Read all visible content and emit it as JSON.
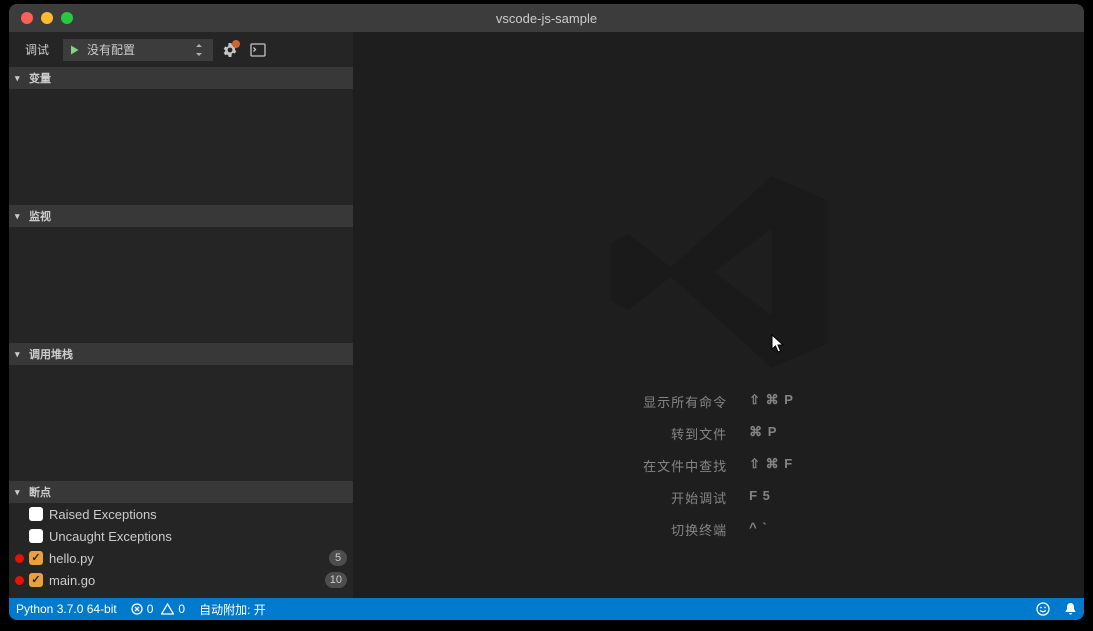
{
  "window": {
    "title": "vscode-js-sample"
  },
  "sidebar": {
    "title": "调试",
    "config": {
      "label": "没有配置"
    },
    "panels": {
      "variables": "变量",
      "watch": "监视",
      "callstack": "调用堆栈",
      "breakpoints": "断点"
    },
    "breakpoints": [
      {
        "label": "Raised Exceptions",
        "checked": false,
        "dot": false,
        "badge": ""
      },
      {
        "label": "Uncaught Exceptions",
        "checked": false,
        "dot": false,
        "badge": ""
      },
      {
        "label": "hello.py",
        "checked": true,
        "dot": true,
        "badge": "5"
      },
      {
        "label": "main.go",
        "checked": true,
        "dot": true,
        "badge": "10"
      }
    ]
  },
  "editor": {
    "shortcuts": [
      {
        "label": "显示所有命令",
        "key": "⇧ ⌘ P"
      },
      {
        "label": "转到文件",
        "key": "⌘ P"
      },
      {
        "label": "在文件中查找",
        "key": "⇧ ⌘ F"
      },
      {
        "label": "开始调试",
        "key": "F 5"
      },
      {
        "label": "切换终端",
        "key": "^ `"
      }
    ]
  },
  "statusbar": {
    "python": "Python 3.7.0 64-bit",
    "errors": "0",
    "warnings": "0",
    "autoattach": "自动附加: 开"
  }
}
